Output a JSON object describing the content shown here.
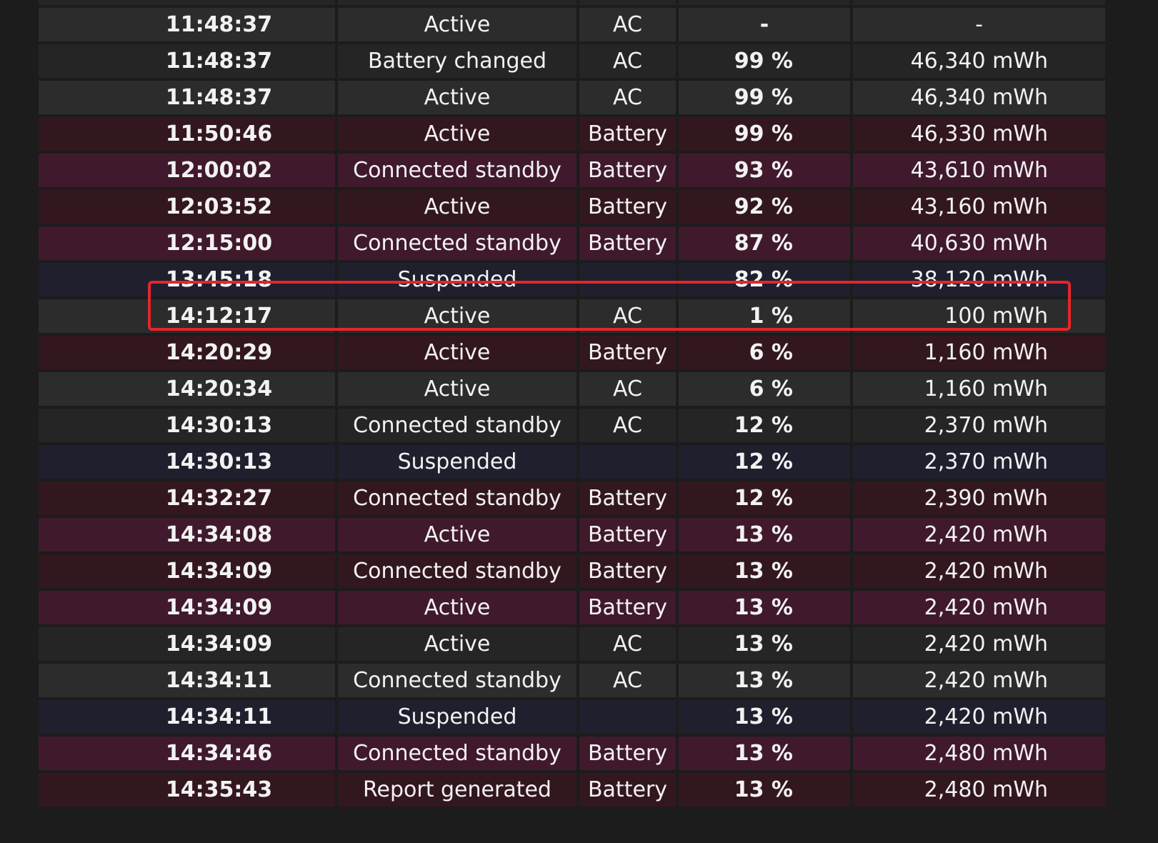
{
  "table": {
    "rows": [
      {
        "time": "",
        "state": "",
        "source": "",
        "percent": "",
        "capacity": "",
        "style": "ac-b"
      },
      {
        "time": "11:48:37",
        "state": "Active",
        "source": "AC",
        "percent": "-",
        "capacity": "-",
        "style": "ac-a"
      },
      {
        "time": "11:48:37",
        "state": "Battery changed",
        "source": "AC",
        "percent": "99 %",
        "capacity": "46,340 mWh",
        "style": "ac-b"
      },
      {
        "time": "11:48:37",
        "state": "Active",
        "source": "AC",
        "percent": "99 %",
        "capacity": "46,340 mWh",
        "style": "ac-a"
      },
      {
        "time": "11:50:46",
        "state": "Active",
        "source": "Battery",
        "percent": "99 %",
        "capacity": "46,330 mWh",
        "style": "bat-a"
      },
      {
        "time": "12:00:02",
        "state": "Connected standby",
        "source": "Battery",
        "percent": "93 %",
        "capacity": "43,610 mWh",
        "style": "bat-b"
      },
      {
        "time": "12:03:52",
        "state": "Active",
        "source": "Battery",
        "percent": "92 %",
        "capacity": "43,160 mWh",
        "style": "bat-a"
      },
      {
        "time": "12:15:00",
        "state": "Connected standby",
        "source": "Battery",
        "percent": "87 %",
        "capacity": "40,630 mWh",
        "style": "bat-b"
      },
      {
        "time": "13:45:18",
        "state": "Suspended",
        "source": "",
        "percent": "82 %",
        "capacity": "38,120 mWh",
        "style": "sus"
      },
      {
        "time": "14:12:17",
        "state": "Active",
        "source": "AC",
        "percent": "1 %",
        "capacity": "100 mWh",
        "style": "ac-a"
      },
      {
        "time": "14:20:29",
        "state": "Active",
        "source": "Battery",
        "percent": "6 %",
        "capacity": "1,160 mWh",
        "style": "bat-a"
      },
      {
        "time": "14:20:34",
        "state": "Active",
        "source": "AC",
        "percent": "6 %",
        "capacity": "1,160 mWh",
        "style": "ac-a"
      },
      {
        "time": "14:30:13",
        "state": "Connected standby",
        "source": "AC",
        "percent": "12 %",
        "capacity": "2,370 mWh",
        "style": "ac-b"
      },
      {
        "time": "14:30:13",
        "state": "Suspended",
        "source": "",
        "percent": "12 %",
        "capacity": "2,370 mWh",
        "style": "sus"
      },
      {
        "time": "14:32:27",
        "state": "Connected standby",
        "source": "Battery",
        "percent": "12 %",
        "capacity": "2,390 mWh",
        "style": "bat-a"
      },
      {
        "time": "14:34:08",
        "state": "Active",
        "source": "Battery",
        "percent": "13 %",
        "capacity": "2,420 mWh",
        "style": "bat-b"
      },
      {
        "time": "14:34:09",
        "state": "Connected standby",
        "source": "Battery",
        "percent": "13 %",
        "capacity": "2,420 mWh",
        "style": "bat-a"
      },
      {
        "time": "14:34:09",
        "state": "Active",
        "source": "Battery",
        "percent": "13 %",
        "capacity": "2,420 mWh",
        "style": "bat-b"
      },
      {
        "time": "14:34:09",
        "state": "Active",
        "source": "AC",
        "percent": "13 %",
        "capacity": "2,420 mWh",
        "style": "ac-b"
      },
      {
        "time": "14:34:11",
        "state": "Connected standby",
        "source": "AC",
        "percent": "13 %",
        "capacity": "2,420 mWh",
        "style": "ac-a"
      },
      {
        "time": "14:34:11",
        "state": "Suspended",
        "source": "",
        "percent": "13 %",
        "capacity": "2,420 mWh",
        "style": "sus"
      },
      {
        "time": "14:34:46",
        "state": "Connected standby",
        "source": "Battery",
        "percent": "13 %",
        "capacity": "2,480 mWh",
        "style": "bat-b"
      },
      {
        "time": "14:35:43",
        "state": "Report generated",
        "source": "Battery",
        "percent": "13 %",
        "capacity": "2,480 mWh",
        "style": "bat-a"
      }
    ]
  },
  "highlight": {
    "row_index": 9,
    "color": "#e6252a"
  }
}
